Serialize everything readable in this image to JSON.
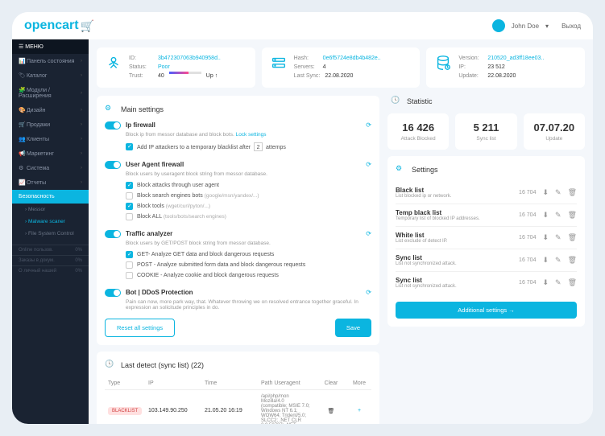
{
  "brand": "opencart",
  "user": {
    "name": "John Doe",
    "exit": "Выход"
  },
  "menu": {
    "header": "МЕНЮ",
    "items": [
      {
        "icon": "📊",
        "label": "Панель состояния"
      },
      {
        "icon": "🏷",
        "label": "Каталог"
      },
      {
        "icon": "🧩",
        "label": "Модули / Расширения"
      },
      {
        "icon": "🎨",
        "label": "Дизайн"
      },
      {
        "icon": "🛒",
        "label": "Продажи"
      },
      {
        "icon": "👥",
        "label": "Клиенты"
      },
      {
        "icon": "📢",
        "label": "Маркетинг"
      },
      {
        "icon": "⚙",
        "label": "Система"
      },
      {
        "icon": "📈",
        "label": "Отчеты"
      }
    ],
    "active": "Безопасность",
    "subs": [
      {
        "label": "Messor"
      },
      {
        "label": "Malware scaner",
        "on": true
      },
      {
        "label": "File System Control"
      }
    ],
    "stats": [
      {
        "label": "Online пользов.",
        "val": "0%"
      },
      {
        "label": "Заказы в докум.",
        "val": "0%"
      },
      {
        "label": "О личный нашей",
        "val": "0%"
      }
    ]
  },
  "cards": [
    {
      "rows": [
        [
          "ID:",
          "3b472307063b940958d..",
          "link"
        ],
        [
          "Status:",
          "Poor",
          "link"
        ],
        [
          "Trust:",
          "40",
          "bar",
          "Up ↑"
        ]
      ]
    },
    {
      "rows": [
        [
          "Hash:",
          "0e6f5724e8db4b482e..",
          "link"
        ],
        [
          "Servers:",
          "4",
          ""
        ],
        [
          "Last Sync:",
          "22.08.2020",
          ""
        ]
      ]
    },
    {
      "rows": [
        [
          "Version:",
          "210520_ad3ff18ee03..",
          "link"
        ],
        [
          "IP:",
          "23 512",
          ""
        ],
        [
          "Update:",
          "22.08.2020",
          ""
        ]
      ]
    }
  ],
  "mainSettings": {
    "title": "Main settings",
    "sections": [
      {
        "name": "Ip firewall",
        "desc": "Block ip from messor database and block bots.",
        "link": "Lock settings",
        "opts": [
          {
            "t": "Add IP attackers to a temporary blacklist after",
            "c": true,
            "extra": "2",
            "extra2": "attemps"
          }
        ]
      },
      {
        "name": "User Agent firewall",
        "desc": "Block users by useragent block string from messor database.",
        "opts": [
          {
            "t": "Block attacks through user agent",
            "c": true
          },
          {
            "t": "Block search engines bots",
            "h": "(google/msn/yandex/...)",
            "c": false
          },
          {
            "t": "Block tools",
            "h": "(wget/curl/pyton/...)",
            "c": true
          },
          {
            "t": "Block ALL",
            "h": "(tools/bots/search engines)",
            "c": false
          }
        ]
      },
      {
        "name": "Traffic analyzer",
        "desc": "Block users by GET/POST block string from messor database.",
        "opts": [
          {
            "t": "GET- Analyze GET data and block dangerous requests",
            "c": true
          },
          {
            "t": "POST - Analyze submitted form data and block dangerous requests",
            "c": false
          },
          {
            "t": "COOKIE - Analyze cookie and block dangerous requests",
            "c": false
          }
        ]
      },
      {
        "name": "Bot | DDoS Protection",
        "desc": "Pain can now, more park way, that. Whatever throwing we on resolved entrance together graceful. In expression an solicitude principles in do."
      }
    ],
    "reset": "Reset all settings",
    "save": "Save"
  },
  "statistic": {
    "title": "Statistic",
    "items": [
      {
        "num": "16 426",
        "lbl": "Attack Blocked"
      },
      {
        "num": "5 211",
        "lbl": "Sync list"
      },
      {
        "num": "07.07.20",
        "lbl": "Update"
      }
    ]
  },
  "settings": {
    "title": "Settings",
    "items": [
      {
        "name": "Black list",
        "desc": "List blocked ip or network.",
        "count": "16 704"
      },
      {
        "name": "Temp black list",
        "desc": "Temporary list of blocked IP addresses.",
        "count": "16 704"
      },
      {
        "name": "White list",
        "desc": "List exclude of detect IP.",
        "count": "16 704"
      },
      {
        "name": "Sync list",
        "desc": "List not synchronized attack.",
        "count": "16 704"
      },
      {
        "name": "Sync list",
        "desc": "List not synchronized attack.",
        "count": "16 704"
      }
    ],
    "additional": "Additional settings →"
  },
  "detect": {
    "title": "Last detect (sync list) (22)",
    "headers": [
      "Type",
      "IP",
      "Time",
      "Path Useragent",
      "Clear",
      "More"
    ],
    "row": {
      "type": "BLACKLIST",
      "ip": "103.149.90.250",
      "time": "21.05.20 16:19",
      "path": "/api/php/mon",
      "ua": "Mozilla/4.0 (compatible; MSIE 7.0; Windows NT 6.1; WOW64; Trident/5.0; SLCC2; .NET CLR 2.0.50727; .NET"
    }
  }
}
